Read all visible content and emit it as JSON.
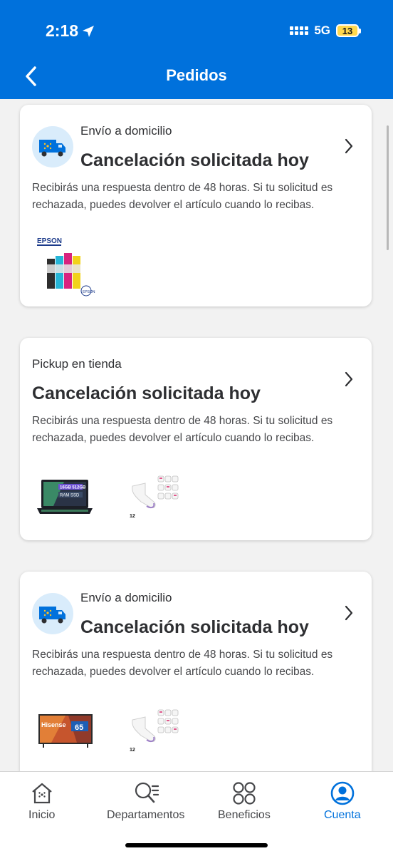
{
  "status_bar": {
    "time": "2:18",
    "network": "5G",
    "battery": "13"
  },
  "header": {
    "title": "Pedidos"
  },
  "orders": [
    {
      "type": "Envío a domicilio",
      "status": "Cancelación solicitada hoy",
      "description": "Recibirás una respuesta dentro de 48 horas. Si tu solicitud es rechazada, puedes devolver el artículo cuando lo recibas.",
      "items": [
        {
          "brand": "EPSON"
        }
      ]
    },
    {
      "type": "Pickup en tienda",
      "status": "Cancelación solicitada hoy",
      "description": "Recibirás una respuesta dentro de 48 horas. Si tu solicitud es rechazada, puedes devolver el artículo cuando lo recibas.",
      "items": [
        {
          "label": "16GB 512GB"
        },
        {
          "count": "12"
        }
      ]
    },
    {
      "type": "Envío a domicilio",
      "status": "Cancelación solicitada hoy",
      "description": "Recibirás una respuesta dentro de 48 horas. Si tu solicitud es rechazada, puedes devolver el artículo cuando lo recibas.",
      "items": [
        {
          "brand": "Hisense",
          "size": "65"
        },
        {
          "count": "12"
        }
      ]
    }
  ],
  "nav": [
    {
      "label": "Inicio",
      "icon": "home-icon"
    },
    {
      "label": "Departamentos",
      "icon": "departments-search-icon"
    },
    {
      "label": "Beneficios",
      "icon": "benefits-grid-icon"
    },
    {
      "label": "Cuenta",
      "icon": "account-icon",
      "active": true
    }
  ],
  "colors": {
    "brand": "#0071dc",
    "background": "#f2f2f2",
    "battery": "#ffd84d"
  }
}
